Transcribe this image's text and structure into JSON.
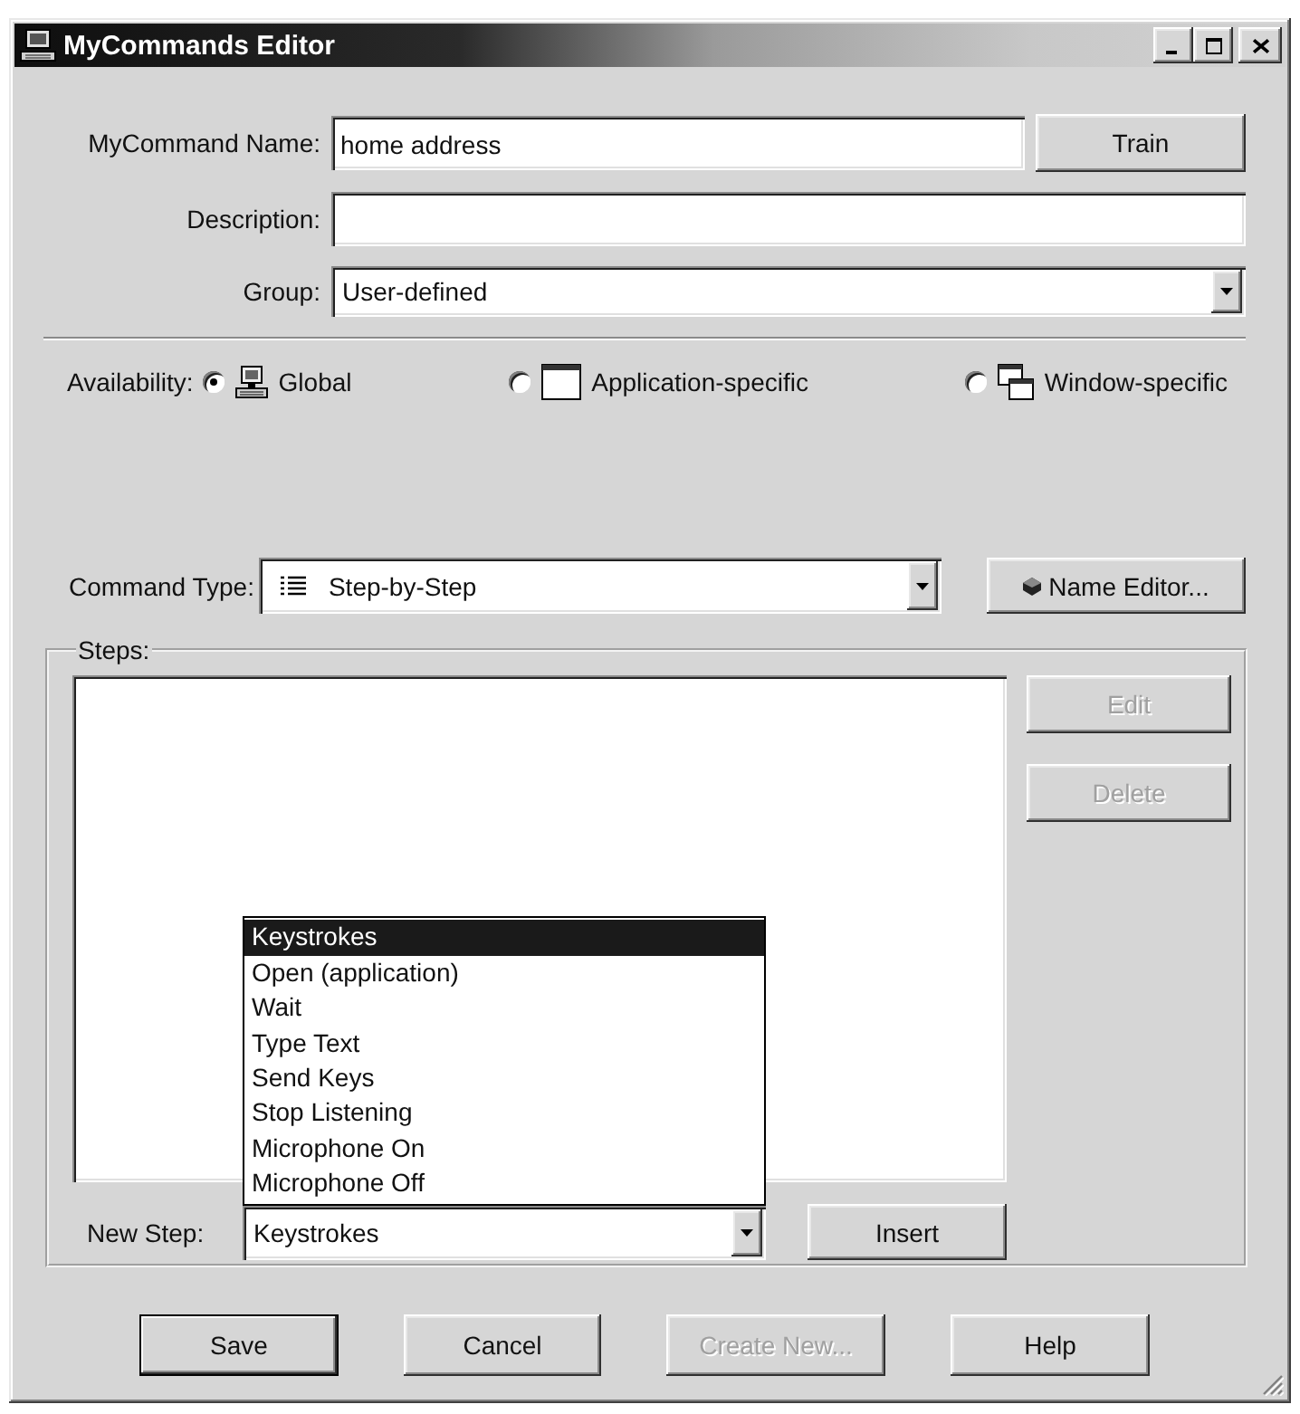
{
  "window": {
    "title": "MyCommands Editor"
  },
  "fields": [
    {
      "label": "MyCommand Name:",
      "kind": "text",
      "value": "home address",
      "button": "Train"
    },
    {
      "label": "Description:",
      "kind": "text"
    },
    {
      "label": "Group:",
      "kind": "dropdown",
      "value": "User-defined"
    }
  ],
  "availability": {
    "label": "Availability:",
    "options": [
      {
        "label": "Global",
        "selected": true
      },
      {
        "label": "Application-specific",
        "selected": false
      },
      {
        "label": "Window-specific",
        "selected": false
      }
    ]
  },
  "command_type": {
    "label": "Command Type:",
    "value": "Step-by-Step",
    "button": "Name Editor..."
  },
  "steps": {
    "label": "Steps:",
    "buttons": [
      {
        "label": "Edit",
        "disabled": true
      },
      {
        "label": "Delete",
        "disabled": true
      }
    ]
  },
  "new_step": {
    "label": "New Step:",
    "value": "Keystrokes",
    "expanded": true,
    "options": [
      {
        "label": "Keystrokes",
        "selected": true
      },
      {
        "label": "Open (application)",
        "selected": false
      },
      {
        "label": "Wait",
        "selected": false
      },
      {
        "label": "Type Text",
        "selected": false
      },
      {
        "label": "Send Keys",
        "selected": false
      },
      {
        "label": "Stop Listening",
        "selected": false
      },
      {
        "label": "Microphone On",
        "selected": false
      },
      {
        "label": "Microphone Off",
        "selected": false
      }
    ],
    "button": "Insert"
  },
  "buttons": [
    {
      "label": "Save",
      "default": true,
      "disabled": false
    },
    {
      "label": "Cancel",
      "default": false,
      "disabled": false
    },
    {
      "label": "Create New...",
      "default": false,
      "disabled": true
    },
    {
      "label": "Help",
      "default": false,
      "disabled": false
    }
  ]
}
